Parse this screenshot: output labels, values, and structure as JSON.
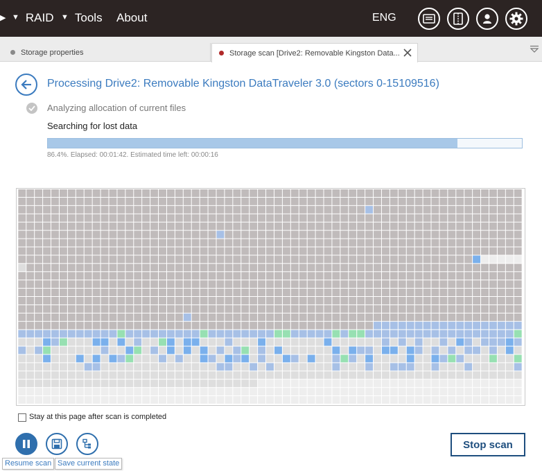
{
  "menu": {
    "items": [
      {
        "label": "RAID"
      },
      {
        "label": "Tools"
      },
      {
        "label": "About"
      }
    ],
    "language": "ENG",
    "icons": [
      "log-icon",
      "panel-toggle-icon",
      "user-icon",
      "settings-icon"
    ]
  },
  "tabs": [
    {
      "label": "Storage properties",
      "status_color": "#8a8a8a",
      "active": false
    },
    {
      "label": "Storage scan [Drive2: Removable Kingston Data...",
      "status_color": "#b02a2a",
      "active": true
    }
  ],
  "scan": {
    "title": "Processing Drive2: Removable Kingston DataTraveler 3.0 (sectors 0-15109516)",
    "step_done": "Analyzing allocation of current files",
    "step_current": "Searching for lost data",
    "progress_fraction": 0.864,
    "progress_text": "86.4%. Elapsed: 00:01:42. Estimated time left: 00:00:16"
  },
  "sector_map": {
    "columns": 61,
    "rows": 26,
    "colors": {
      "scanned": "#c0bbbb",
      "unscanned": "#eeeeee",
      "pending": "#dedede",
      "found_blue": "#a7c0e6",
      "found_bright": "#7ab0ec",
      "found_green": "#97e0b2"
    }
  },
  "stay_on_page": {
    "label": "Stay at this page after scan is completed",
    "checked": false
  },
  "actions": {
    "tooltip_resume": "Resume scan",
    "tooltip_save": "Save current state",
    "stop_label": "Stop scan"
  }
}
